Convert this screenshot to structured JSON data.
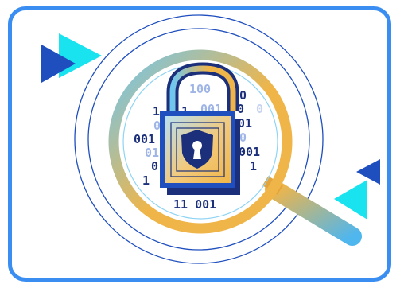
{
  "illustration": {
    "colors": {
      "frame_border": "#3a8ef2",
      "dark_blue": "#1f4fbf",
      "navy": "#1b2f7a",
      "cyan": "#19e3ef",
      "sky_blue": "#6fc6f0",
      "gold": "#f0b548",
      "light_blue_digits": "#9fb5e6"
    },
    "binary": {
      "top": "100",
      "top_right": "0",
      "row2_a": "1",
      "row2_b": "1",
      "row2_c": "001",
      "row2_d": "0",
      "row2_e": "0",
      "row3_left": "0",
      "row3_right": "01",
      "row4_left": "001",
      "row4_right": "0",
      "row5_left": "01",
      "row5_right": "001",
      "row6_left": "0",
      "row6_right": "1",
      "row7_left": "1",
      "bottom": "11 001"
    }
  }
}
